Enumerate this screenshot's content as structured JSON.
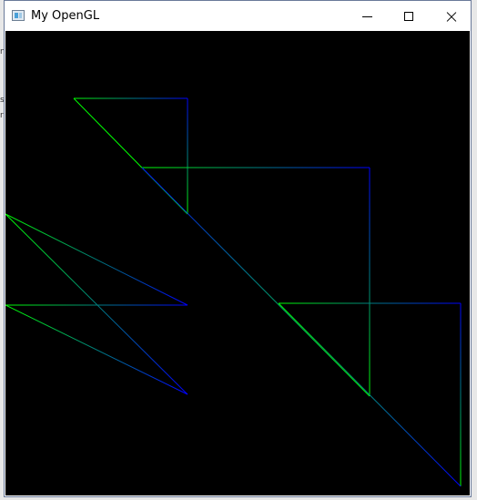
{
  "window": {
    "title": "My OpenGL",
    "buttons": {
      "minimize": "minimize",
      "maximize": "maximize",
      "close": "close"
    }
  },
  "background_fragments": [
    "s",
    "r",
    "n"
  ],
  "scene": {
    "background": "#000000",
    "colors": {
      "green": "#00ff00",
      "blue": "#0000ff"
    }
  }
}
